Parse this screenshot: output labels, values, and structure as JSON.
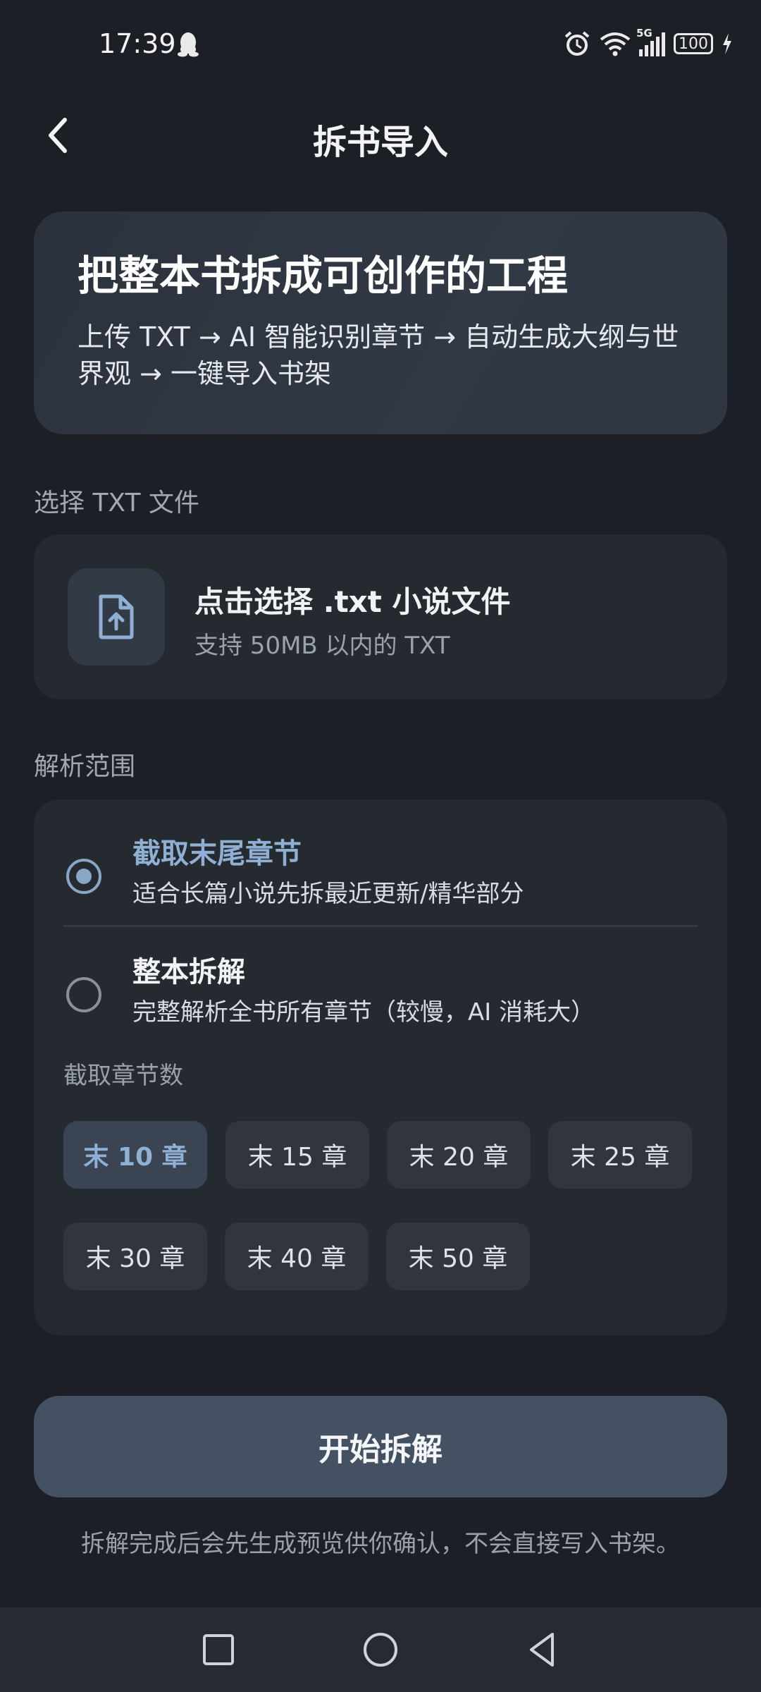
{
  "status_bar": {
    "time": "17:39",
    "network": "5G",
    "battery": "100",
    "icons": [
      "qq-icon",
      "alarm-icon",
      "wifi-icon",
      "signal-icon",
      "battery-icon",
      "charging-icon"
    ]
  },
  "header": {
    "title": "拆书导入",
    "back_icon": "back-chevron-icon"
  },
  "hero": {
    "title": "把整本书拆成可创作的工程",
    "description": "上传 TXT → AI 智能识别章节 → 自动生成大纲与世界观 → 一键导入书架"
  },
  "file_section": {
    "label": "选择 TXT 文件",
    "title": "点击选择 .txt 小说文件",
    "subtitle": "支持 50MB 以内的 TXT",
    "icon": "file-upload-icon"
  },
  "range_section": {
    "label": "解析范围",
    "options": [
      {
        "title": "截取末尾章节",
        "desc": "适合长篇小说先拆最近更新/精华部分",
        "selected": true
      },
      {
        "title": "整本拆解",
        "desc": "完整解析全书所有章节（较慢，AI 消耗大）",
        "selected": false
      }
    ],
    "count_label": "截取章节数",
    "chips": [
      "末 10 章",
      "末 15 章",
      "末 20 章",
      "末 25 章",
      "末 30 章",
      "末 40 章",
      "末 50 章"
    ],
    "selected_chip": "末 10 章"
  },
  "actions": {
    "start_label": "开始拆解",
    "note": "拆解完成后会先生成预览供你确认，不会直接写入书架。"
  },
  "nav_bar": {
    "icons": [
      "recents-square-icon",
      "home-circle-icon",
      "back-triangle-icon"
    ]
  },
  "colors": {
    "background": "#1c1f25",
    "card": "#252930",
    "accent": "#8fb0d3",
    "button": "#435162"
  }
}
